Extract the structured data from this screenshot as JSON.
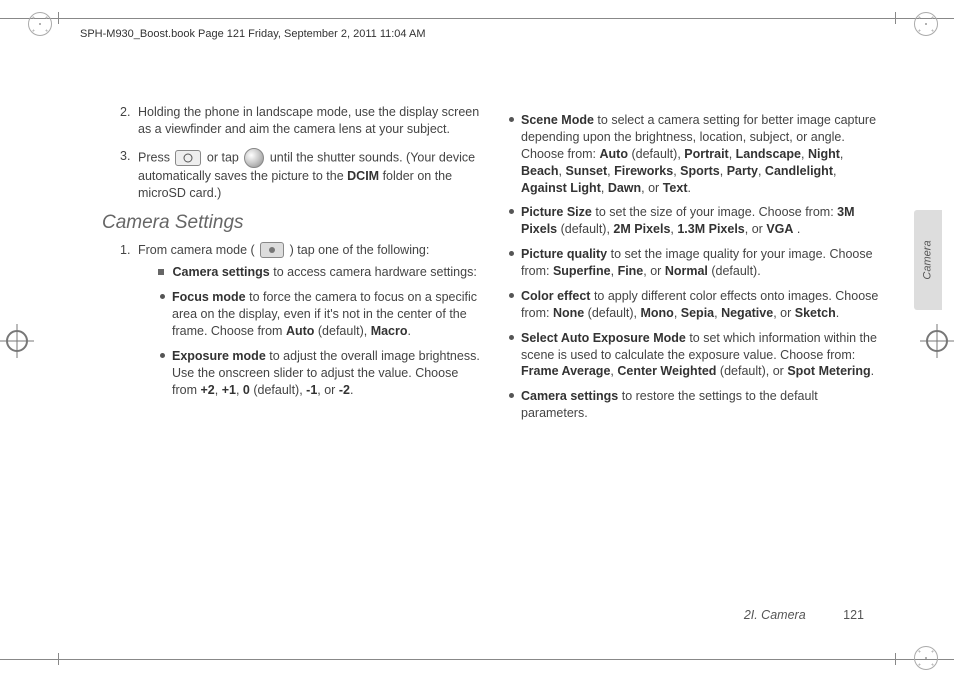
{
  "header": {
    "stamp": "SPH-M930_Boost.book  Page 121  Friday, September 2, 2011  11:04 AM"
  },
  "sideTab": {
    "label": "Camera"
  },
  "footer": {
    "section": "2I. Camera",
    "page": "121"
  },
  "step2": {
    "num": "2.",
    "text": "Holding the phone in landscape mode, use the display screen as a viewfinder and aim the camera lens at your subject."
  },
  "step3": {
    "num": "3.",
    "pre": "Press ",
    "mid": " or tap ",
    "post": " until the shutter sounds. (Your device automatically saves the picture to the ",
    "bold": "DCIM",
    "tail": " folder on the microSD card.)"
  },
  "heading": "Camera Settings",
  "cs1": {
    "num": "1.",
    "pre": "From camera mode (",
    "post": ") tap one of the following:"
  },
  "csSub": {
    "label": "Camera settings",
    "tail": " to access camera hardware settings:"
  },
  "focus": {
    "label": "Focus mode",
    "text": " to force the camera to focus on a specific area on the display, even if it's not in the center of the frame. Choose from ",
    "opt1": "Auto",
    "opt1t": " (default), ",
    "opt2": "Macro",
    "tail": "."
  },
  "exposure": {
    "label": "Exposure mode",
    "text": " to adjust the overall image brightness. Use the onscreen slider to adjust the value. Choose from ",
    "o1": "+2",
    "c": ", ",
    "o2": "+1",
    "o3": "0",
    "o3t": " (default), ",
    "o4": "-1",
    "o5": "-2",
    "or": ", or ",
    "tail": "."
  },
  "scene": {
    "label": "Scene Mode",
    "text": " to select a camera setting for better image capture depending upon the brightness, location, subject, or angle. Choose from: ",
    "o1": "Auto",
    "o1t": " (default), ",
    "o2": "Portrait",
    "c": ", ",
    "o3": "Landscape",
    "o4": "Night",
    "o5": "Beach",
    "o6": "Sunset",
    "o7": "Fireworks",
    "o8": "Sports",
    "o9": "Party",
    "o10": "Candlelight",
    "o11": "Against Light",
    "o12": "Dawn",
    "or": ", or ",
    "o13": "Text",
    "tail": "."
  },
  "psize": {
    "label": "Picture Size",
    "text": " to set the size of your image. Choose from: ",
    "o1": "3M Pixels",
    "o1t": " (default), ",
    "o2": "2M Pixels",
    "c": ", ",
    "o3": "1.3M Pixels",
    "or": ", or ",
    "o4": "VGA",
    "tail": " ."
  },
  "pqual": {
    "label": "Picture quality",
    "text": " to set the image quality for your image. Choose from: ",
    "o1": "Superfine",
    "c": ", ",
    "o2": "Fine",
    "or": ", or ",
    "o3": "Normal",
    "o3t": " (default).",
    "tail": ""
  },
  "ceffect": {
    "label": "Color effect",
    "text": " to apply different color effects onto images. Choose from: ",
    "o1": "None",
    "o1t": " (default), ",
    "o2": "Mono",
    "c": ", ",
    "o3": "Sepia",
    "o4": "Negative",
    "or": ", or ",
    "o5": "Sketch",
    "tail": "."
  },
  "aemode": {
    "label": "Select Auto Exposure Mode",
    "text": " to set which information within the scene is used to calculate the exposure value. Choose from: ",
    "o1": "Frame Average",
    "c": ", ",
    "o2": "Center Weighted",
    "o2t": " (default), or ",
    "o3": "Spot Metering",
    "tail": "."
  },
  "restore": {
    "label": "Camera settings",
    "text": " to restore the settings to the default parameters."
  }
}
